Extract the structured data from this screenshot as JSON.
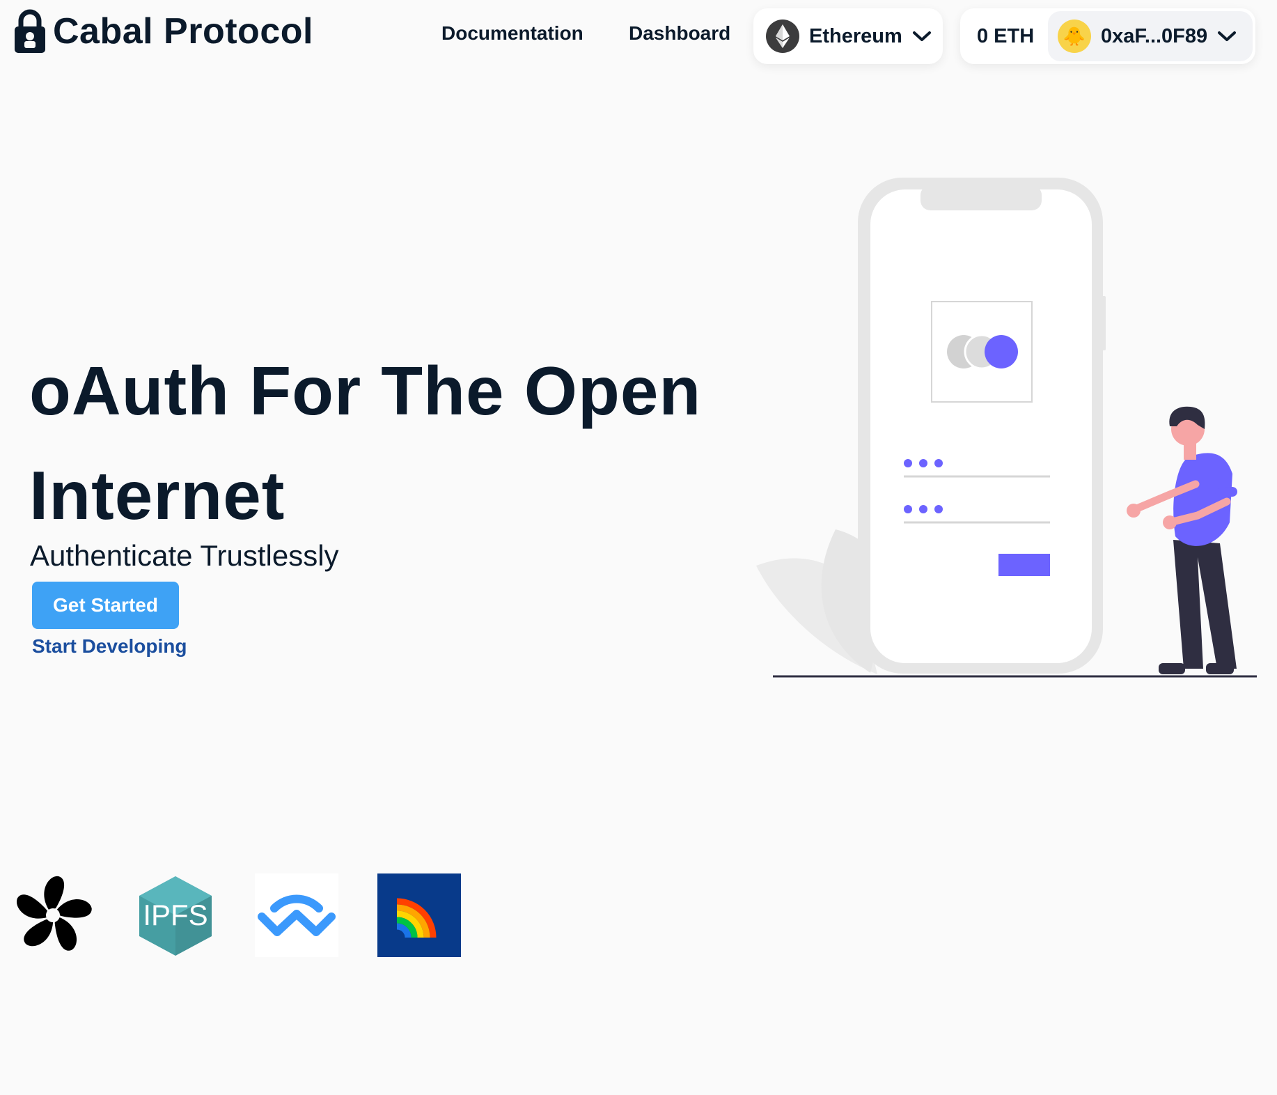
{
  "header": {
    "brand": "Cabal Protocol",
    "nav": [
      {
        "label": "Documentation"
      },
      {
        "label": "Dashboard"
      }
    ],
    "network": {
      "label": "Ethereum",
      "icon": "ethereum-icon"
    },
    "account": {
      "balance": "0 ETH",
      "address": "0xaF...0F89",
      "avatar": "🐥"
    }
  },
  "hero": {
    "title": "oAuth For The Open Internet",
    "subtitle": "Authenticate Trustlessly",
    "primary_button": "Get Started",
    "secondary_link": "Start Developing"
  },
  "partners": [
    {
      "name": "flower-logo"
    },
    {
      "name": "ipfs-logo",
      "text": "IPFS"
    },
    {
      "name": "walletconnect-logo"
    },
    {
      "name": "rainbow-logo"
    }
  ],
  "colors": {
    "background": "#fafafa",
    "text": "#0b1a2b",
    "primary_button": "#3ea2f5",
    "link": "#1b4e9e",
    "accent": "#6c63ff"
  }
}
